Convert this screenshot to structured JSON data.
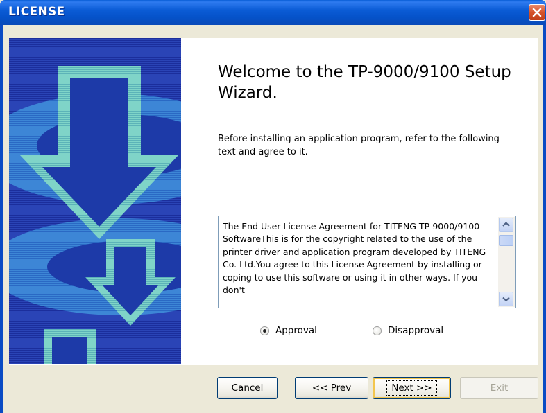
{
  "window": {
    "title": "LICENSE",
    "close_icon": "close-icon"
  },
  "main": {
    "heading": "Welcome to the TP-9000/9100 Setup Wizard.",
    "intro": "Before installing an application program, refer to the following text and agree to it.",
    "license_text": "The End User License Agreement for TITENG TP-9000/9100 SoftwareThis is for the copyright related to the use of the printer driver and application program developed by TITENG Co. Ltd.You agree to this License Agreement by installing or coping to use this software or using it in other ways. If you don't",
    "radios": {
      "approval_label": "Approval",
      "approval_checked": true,
      "disapproval_label": "Disapproval",
      "disapproval_checked": false
    }
  },
  "footer": {
    "cancel_label": "Cancel",
    "prev_label": "<< Prev",
    "next_label": "Next >>",
    "exit_label": "Exit",
    "exit_enabled": false
  },
  "colors": {
    "titlebar": "#0a5fd8",
    "banner_bg": "#1a2f9a",
    "dialog_bg": "#ece9d8"
  }
}
